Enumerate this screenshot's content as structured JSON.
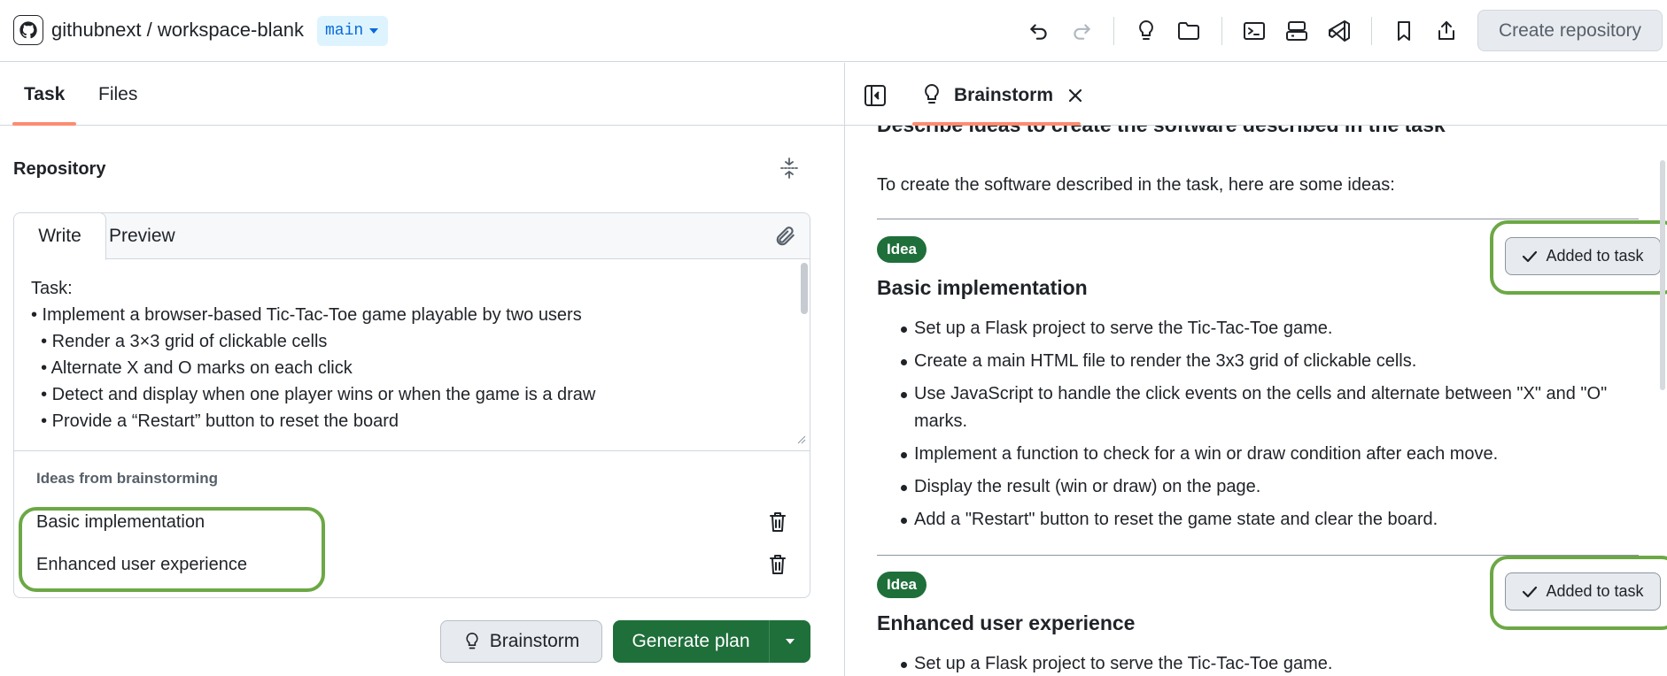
{
  "topbar": {
    "owner": "githubnext",
    "separator": " / ",
    "repo": "workspace-blank",
    "branch": "main",
    "create_repo_label": "Create repository",
    "icons": [
      "undo-icon",
      "redo-icon",
      "lightbulb-icon",
      "folder-icon",
      "terminal-icon",
      "server-icon",
      "vscode-icon",
      "bookmark-icon",
      "share-icon"
    ]
  },
  "left": {
    "tabs": [
      {
        "label": "Task"
      },
      {
        "label": "Files"
      }
    ],
    "section_title": "Repository",
    "editor": {
      "write_label": "Write",
      "preview_label": "Preview",
      "lines": [
        "Task:",
        "• Implement a browser-based Tic-Tac-Toe game playable by two users",
        "  • Render a 3×3 grid of clickable cells",
        "  • Alternate X and O marks on each click",
        "  • Detect and display when one player wins or when the game is a draw",
        "  • Provide a “Restart” button to reset the board"
      ]
    },
    "ideas_label": "Ideas from brainstorming",
    "ideas": [
      {
        "label": "Basic implementation"
      },
      {
        "label": "Enhanced user experience"
      }
    ],
    "brainstorm_label": "Brainstorm",
    "generate_label": "Generate plan"
  },
  "right": {
    "tab_label": "Brainstorm",
    "cut_heading": "Describe ideas to create the software described in the task",
    "intro": "To create the software described in the task, here are some ideas:",
    "ideas": [
      {
        "badge": "Idea",
        "title": "Basic implementation",
        "added_label": "Added to task",
        "bullets": [
          "Set up a Flask project to serve the Tic-Tac-Toe game.",
          "Create a main HTML file to render the 3x3 grid of clickable cells.",
          "Use JavaScript to handle the click events on the cells and alternate between \"X\" and \"O\" marks.",
          "Implement a function to check for a win or draw condition after each move.",
          "Display the result (win or draw) on the page.",
          "Add a \"Restart\" button to reset the game state and clear the board."
        ]
      },
      {
        "badge": "Idea",
        "title": "Enhanced user experience",
        "added_label": "Added to task",
        "bullets": [
          "Set up a Flask project to serve the Tic-Tac-Toe game."
        ]
      }
    ]
  },
  "colors": {
    "accent_green": "#1f6f3b",
    "highlight_outline": "#6ca845",
    "tab_underline": "#fd8c73",
    "branch_bg": "#ddf4ff",
    "branch_text": "#0969da"
  }
}
